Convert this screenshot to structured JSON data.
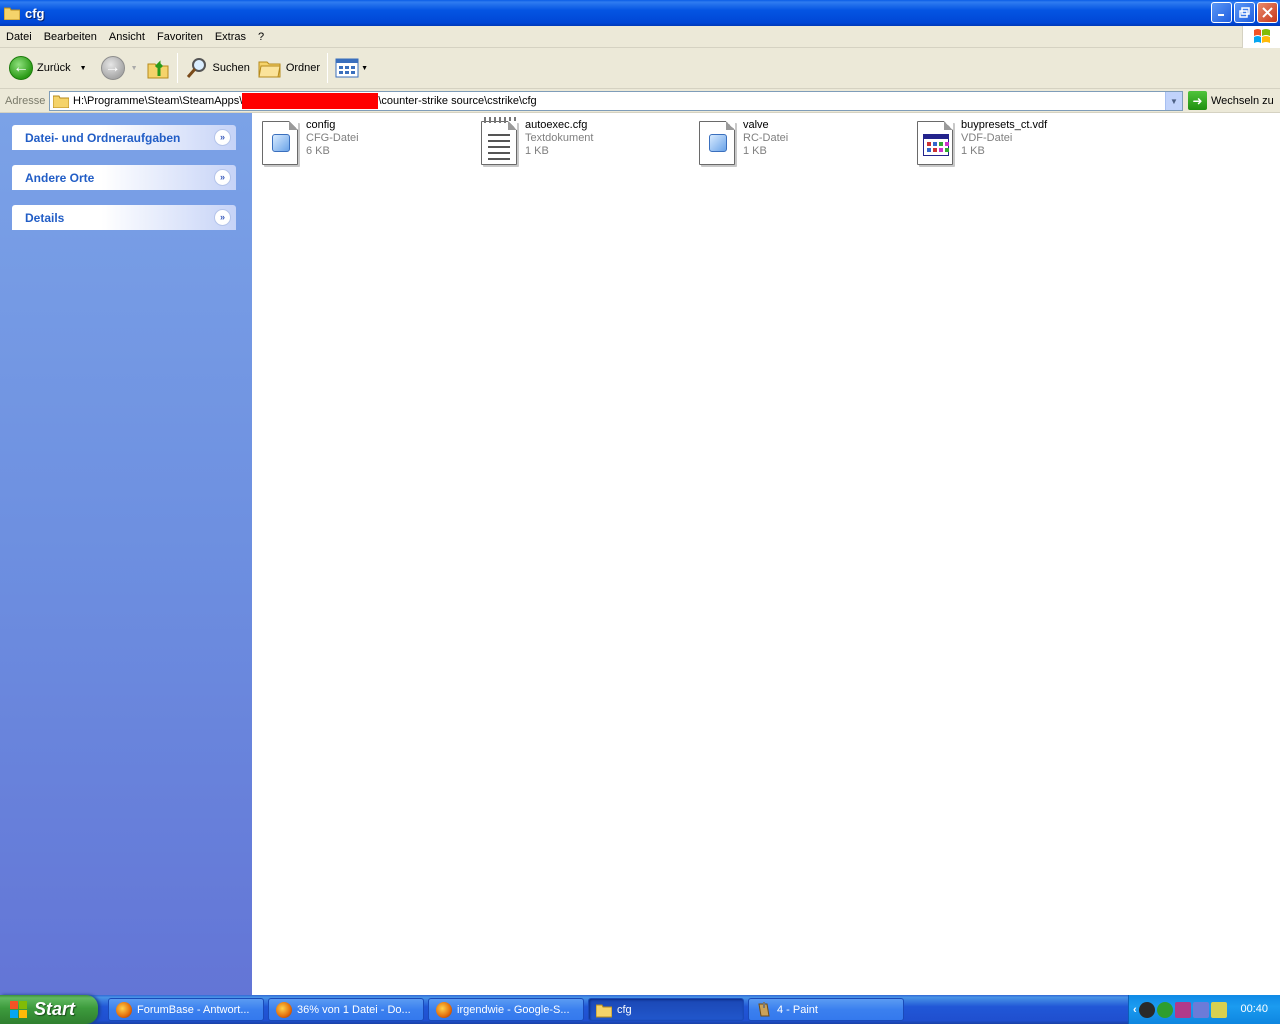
{
  "window": {
    "title": "cfg"
  },
  "menu": [
    "Datei",
    "Bearbeiten",
    "Ansicht",
    "Favoriten",
    "Extras",
    "?"
  ],
  "toolbar": {
    "back_label": "Zurück",
    "search_label": "Suchen",
    "folders_label": "Ordner"
  },
  "address": {
    "label": "Adresse",
    "path_before": "H:\\Programme\\Steam\\SteamApps\\",
    "path_after": "\\counter-strike source\\cstrike\\cfg",
    "go_label": "Wechseln zu"
  },
  "taskpane": {
    "panels": [
      {
        "title": "Datei- und Ordneraufgaben"
      },
      {
        "title": "Andere Orte"
      },
      {
        "title": "Details"
      }
    ]
  },
  "files": [
    {
      "name": "config",
      "type": "CFG-Datei",
      "size": "6 KB",
      "icon": "cfg-file-icon"
    },
    {
      "name": "autoexec.cfg",
      "type": "Textdokument",
      "size": "1 KB",
      "icon": "text-document-icon"
    },
    {
      "name": "valve",
      "type": "RC-Datei",
      "size": "1 KB",
      "icon": "rc-file-icon"
    },
    {
      "name": "buypresets_ct.vdf",
      "type": "VDF-Datei",
      "size": "1 KB",
      "icon": "vdf-file-icon"
    }
  ],
  "taskbar": {
    "start_label": "Start",
    "tasks": [
      {
        "label": "ForumBase - Antwort...",
        "icon": "firefox-icon",
        "active": false
      },
      {
        "label": "36% von 1 Datei - Do...",
        "icon": "firefox-icon",
        "active": false
      },
      {
        "label": "irgendwie - Google-S...",
        "icon": "firefox-icon",
        "active": false
      },
      {
        "label": "cfg",
        "icon": "folder-icon",
        "active": true
      },
      {
        "label": "4 - Paint",
        "icon": "paint-icon",
        "active": false
      }
    ],
    "clock": "00:40"
  },
  "colors": {
    "accent": "#0054e3",
    "taskpane": "#6d8fe0",
    "redaction": "#ff0000"
  }
}
